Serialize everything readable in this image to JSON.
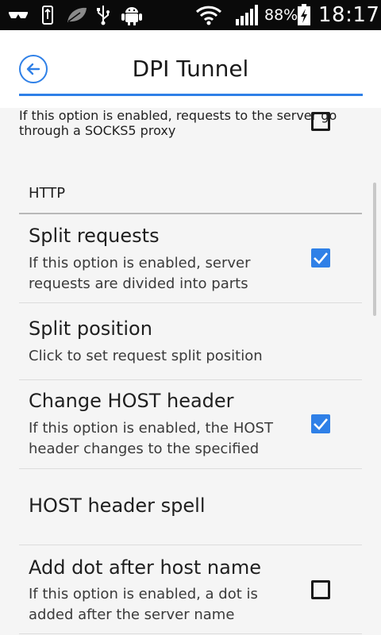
{
  "status_bar": {
    "icons": [
      "glasses-icon",
      "usb-storage-icon",
      "leaf-icon",
      "usb-icon",
      "android-icon",
      "wifi-icon",
      "signal-icon",
      "battery-charging-icon"
    ],
    "battery_percent": "88%",
    "time": "18:17"
  },
  "header": {
    "title": "DPI Tunnel",
    "back_icon": "arrow-left-circle-icon",
    "accent_color": "#2f80e7"
  },
  "socks_item": {
    "summary": "If this option is enabled, requests to the server go through a SOCKS5 proxy",
    "checked": false
  },
  "section": {
    "label": "HTTP"
  },
  "items": [
    {
      "title": "Split requests",
      "summary": "If this option is enabled, server requests are divided into parts",
      "checked": true
    },
    {
      "title": "Split position",
      "summary": "Click to set request split position"
    },
    {
      "title": "Change HOST header",
      "summary": "If this option is enabled, the HOST header changes to the specified",
      "checked": true
    },
    {
      "title": "HOST header spell"
    },
    {
      "title": "Add dot after host name",
      "summary": "If this option is enabled, a dot is added after the server name",
      "checked": false
    }
  ]
}
